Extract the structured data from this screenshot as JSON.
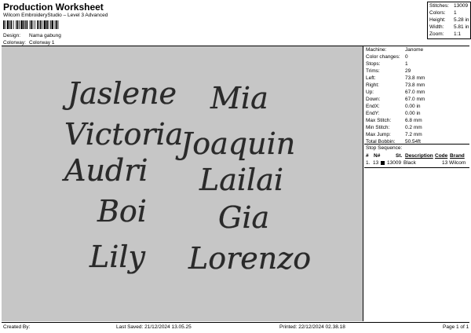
{
  "header": {
    "title": "Production Worksheet",
    "subtitle": "Wilcom EmbroideryStudio – Level 3 Advanced"
  },
  "design_info": {
    "design_label": "Design:",
    "design_value": "Nama gabung",
    "colorway_label": "Colorway:",
    "colorway_value": "Colorway 1"
  },
  "summary": [
    {
      "label": "Stitches:",
      "value": "13009"
    },
    {
      "label": "Colors:",
      "value": "1"
    },
    {
      "label": "Height:",
      "value": "5.28 in"
    },
    {
      "label": "Width:",
      "value": "5.81 in"
    },
    {
      "label": "Zoom:",
      "value": "1:1"
    }
  ],
  "machine_info": [
    {
      "label": "Machine:",
      "value": "Janome"
    },
    {
      "label": "Color changes:",
      "value": "0"
    },
    {
      "label": "Stops:",
      "value": "1"
    },
    {
      "label": "Trims:",
      "value": "29"
    },
    {
      "label": "Left:",
      "value": "73.8 mm"
    },
    {
      "label": "Right:",
      "value": "73.8 mm"
    },
    {
      "label": "Up:",
      "value": "67.0 mm"
    },
    {
      "label": "Down:",
      "value": "67.0 mm"
    },
    {
      "label": "EndX:",
      "value": "0.00 in"
    },
    {
      "label": "EndY:",
      "value": "0.00 in"
    },
    {
      "label": "Max Stitch:",
      "value": "6.8 mm"
    },
    {
      "label": "Min Stitch:",
      "value": "0.2 mm"
    },
    {
      "label": "Max Jump:",
      "value": "7.2 mm"
    },
    {
      "label": "Total Bobbin:",
      "value": "50.54ft"
    }
  ],
  "stop_sequence": {
    "title": "Stop Sequence:",
    "headers": {
      "n": "#",
      "n2": "N#",
      "st": "St.",
      "desc": "Description",
      "code": "Code",
      "brand": "Brand"
    },
    "rows": [
      {
        "n": "1.",
        "n2": "13",
        "st": "13009",
        "desc": "Black",
        "code": "13",
        "brand": "Wilcom",
        "color": "#000000"
      }
    ]
  },
  "design_names": [
    "Jaslene",
    "Mia",
    "Victoria",
    "Joaquin",
    "Audri",
    "Lailai",
    "Boi",
    "Gia",
    "Lily",
    "Lorenzo"
  ],
  "footer": {
    "created_by": "Created By:",
    "last_saved": "Last Saved: 21/12/2024 13.05.25",
    "printed": "Printed: 22/12/2024 02.38.18",
    "page": "Page 1 of 1"
  }
}
